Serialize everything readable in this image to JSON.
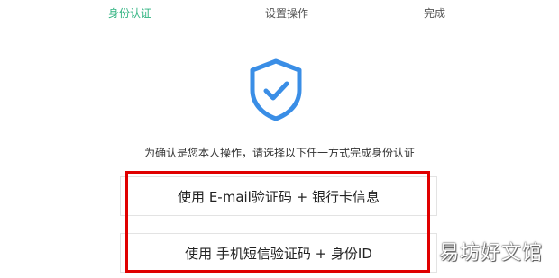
{
  "steps": [
    {
      "label": "身份认证",
      "active": true
    },
    {
      "label": "设置操作",
      "active": false
    },
    {
      "label": "完成",
      "active": false
    }
  ],
  "icon": {
    "name": "shield-check-icon",
    "color": "#3a8ee6"
  },
  "instruction": "为确认是您本人操作，请选择以下任一方式完成身份认证",
  "options": [
    {
      "label": "使用 E-mail验证码 + 银行卡信息"
    },
    {
      "label": "使用 手机短信验证码 + 身份ID"
    }
  ],
  "colors": {
    "active_step": "#2fb380",
    "highlight": "#e00000"
  },
  "watermark": "易坊好文馆"
}
